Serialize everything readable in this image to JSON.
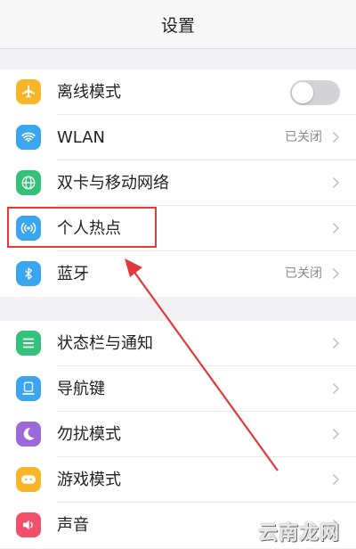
{
  "header": {
    "title": "设置"
  },
  "group1": {
    "items": [
      {
        "label": "离线模式",
        "icon": "airplane-icon",
        "color": "#f7b52a"
      },
      {
        "label": "WLAN",
        "icon": "wifi-icon",
        "color": "#3aa6f0",
        "status": "已关闭"
      },
      {
        "label": "双卡与移动网络",
        "icon": "globe-icon",
        "color": "#34c27a"
      },
      {
        "label": "个人热点",
        "icon": "hotspot-icon",
        "color": "#3aa6f0"
      },
      {
        "label": "蓝牙",
        "icon": "bluetooth-icon",
        "color": "#3aa6f0",
        "status": "已关闭"
      }
    ]
  },
  "group2": {
    "items": [
      {
        "label": "状态栏与通知",
        "icon": "statusbar-icon",
        "color": "#34c27a"
      },
      {
        "label": "导航键",
        "icon": "navigation-icon",
        "color": "#3aa6f0"
      },
      {
        "label": "勿扰模式",
        "icon": "moon-icon",
        "color": "#9b6ad8"
      },
      {
        "label": "游戏模式",
        "icon": "game-icon",
        "color": "#f7b52a"
      },
      {
        "label": "声音",
        "icon": "speaker-icon",
        "color": "#f0506a"
      }
    ]
  },
  "toggle": {
    "airplane_mode_on": false
  },
  "annotation": {
    "highlight_color": "#e03a3a"
  },
  "watermark": {
    "text": "云南龙网"
  }
}
